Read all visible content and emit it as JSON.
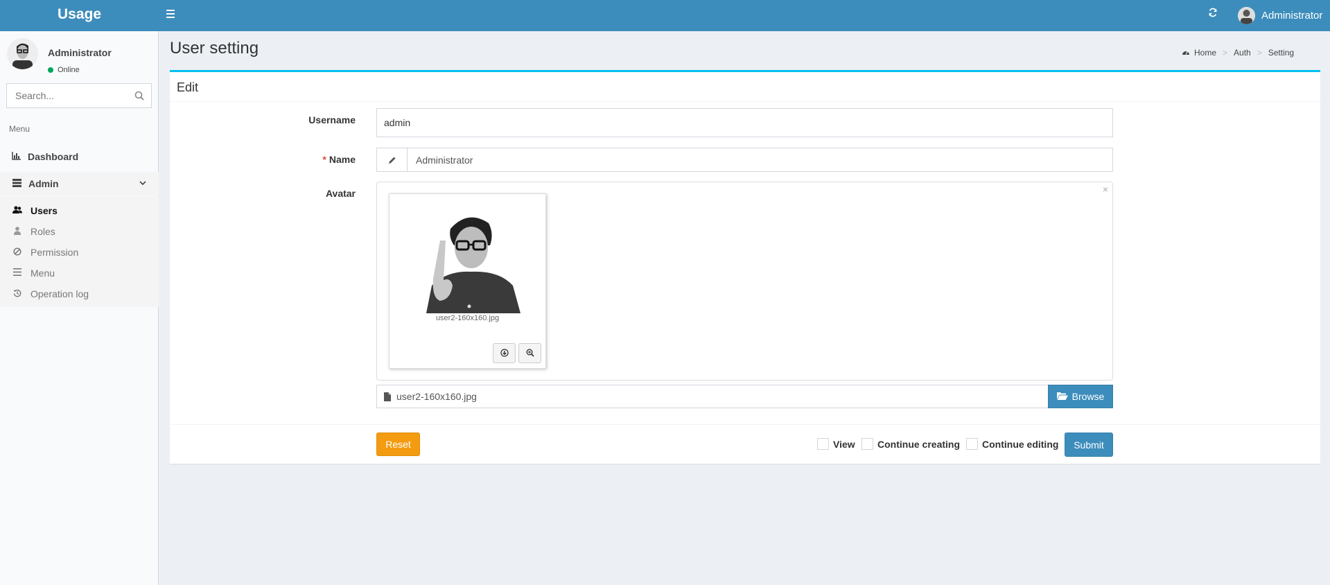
{
  "header": {
    "logo": "Usage",
    "toggle_icon": "bars-icon",
    "refresh_icon": "refresh-icon",
    "user_name": "Administrator"
  },
  "sidebar": {
    "user_name": "Administrator",
    "user_status": "Online",
    "search_placeholder": "Search...",
    "menu_header": "Menu",
    "dashboard_label": "Dashboard",
    "admin_label": "Admin",
    "items": [
      {
        "label": "Users",
        "icon": "users-icon",
        "active": true
      },
      {
        "label": "Roles",
        "icon": "user-icon",
        "active": false
      },
      {
        "label": "Permission",
        "icon": "ban-icon",
        "active": false
      },
      {
        "label": "Menu",
        "icon": "bars-icon",
        "active": false
      },
      {
        "label": "Operation log",
        "icon": "history-icon",
        "active": false
      }
    ]
  },
  "page": {
    "title": "User setting",
    "breadcrumb": [
      "Home",
      "Auth",
      "Setting"
    ]
  },
  "form": {
    "box_title": "Edit",
    "username_label": "Username",
    "username_value": "admin",
    "name_required_mark": "*",
    "name_label": "Name",
    "name_value": "Administrator",
    "avatar_label": "Avatar",
    "avatar_preview_caption": "user2-160x160.jpg",
    "avatar_file_name": "user2-160x160.jpg",
    "browse_label": "Browse",
    "reset_label": "Reset",
    "view_label": "View",
    "continue_creating_label": "Continue creating",
    "continue_editing_label": "Continue editing",
    "submit_label": "Submit"
  },
  "colors": {
    "header_bg": "#3c8dbc",
    "box_top_border": "#00c0ef",
    "reset": "#f39c12",
    "submit": "#3c8dbc",
    "online": "#00a65a",
    "required": "#dd4b39"
  }
}
